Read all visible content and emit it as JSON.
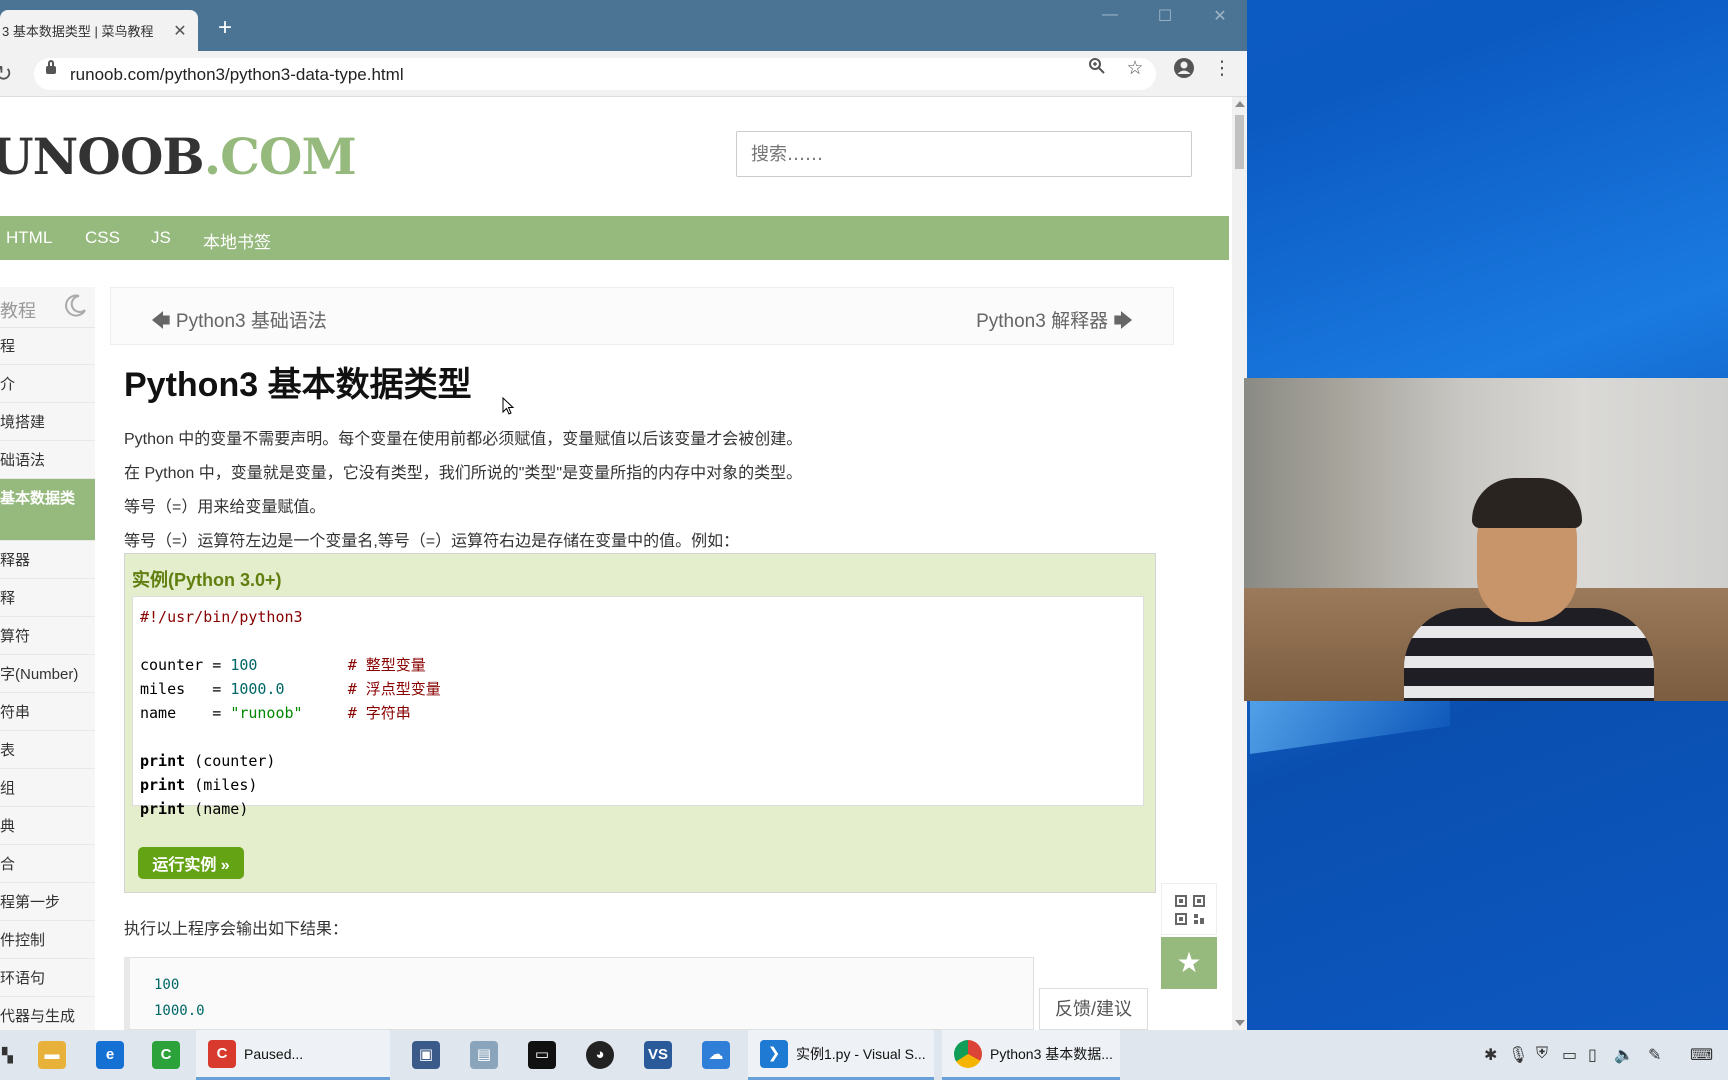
{
  "browser": {
    "tab_title": "3 基本数据类型 | 菜鸟教程",
    "tab_close": "✕",
    "new_tab": "+",
    "url": "runoob.com/python3/python3-data-type.html",
    "window_controls": {
      "minimize": "—",
      "maximize": "☐",
      "close": "✕"
    }
  },
  "site": {
    "logo_main": "UNOOB",
    "logo_suffix": ".COM",
    "search_placeholder": "搜索……",
    "nav": [
      "HTML",
      "CSS",
      "JS",
      "本地书签"
    ]
  },
  "sidebar": {
    "header": "教程",
    "items": [
      "程",
      "介",
      "境搭建",
      "础语法",
      "基本数据类",
      "释器",
      "释",
      "算符",
      "字(Number)",
      "符串",
      "表",
      "组",
      "典",
      "合",
      "程第一步",
      "件控制",
      "环语句",
      "代器与生成"
    ],
    "active_index": 4
  },
  "article": {
    "prev": "Python3 基础语法",
    "next": "Python3 解释器",
    "title": "Python3 基本数据类型",
    "paragraphs": [
      "Python 中的变量不需要声明。每个变量在使用前都必须赋值，变量赋值以后该变量才会被创建。",
      "在 Python 中，变量就是变量，它没有类型，我们所说的\"类型\"是变量所指的内存中对象的类型。",
      "等号（=）用来给变量赋值。",
      "等号（=）运算符左边是一个变量名,等号（=）运算符右边是存储在变量中的值。例如："
    ],
    "example_title": "实例(Python 3.0+)",
    "code": {
      "shebang": "#!/usr/bin/python3",
      "lines": [
        {
          "var": "counter",
          "pad": " = ",
          "val": "100",
          "gap": "          ",
          "comment": "# 整型变量",
          "valtype": "num"
        },
        {
          "var": "miles  ",
          "pad": " = ",
          "val": "1000.0",
          "gap": "       ",
          "comment": "# 浮点型变量",
          "valtype": "num"
        },
        {
          "var": "name   ",
          "pad": " = ",
          "val": "\"runoob\"",
          "gap": "     ",
          "comment": "# 字符串",
          "valtype": "str"
        }
      ],
      "prints": [
        {
          "kw": "print",
          "arg": " (counter)"
        },
        {
          "kw": "print",
          "arg": " (miles)"
        },
        {
          "kw": "print",
          "arg": " (name)"
        }
      ]
    },
    "run_button": "运行实例 »",
    "output_intro": "执行以上程序会输出如下结果：",
    "output": [
      "100",
      "1000.0"
    ]
  },
  "floating": {
    "feedback": "反馈/建议",
    "qr_icon": "qr-code-icon",
    "star_icon": "star-icon"
  },
  "taskbar": {
    "paused_label": "Paused...",
    "vscode_label": "实例1.py - Visual S...",
    "chrome_label": "Python3 基本数据..."
  }
}
